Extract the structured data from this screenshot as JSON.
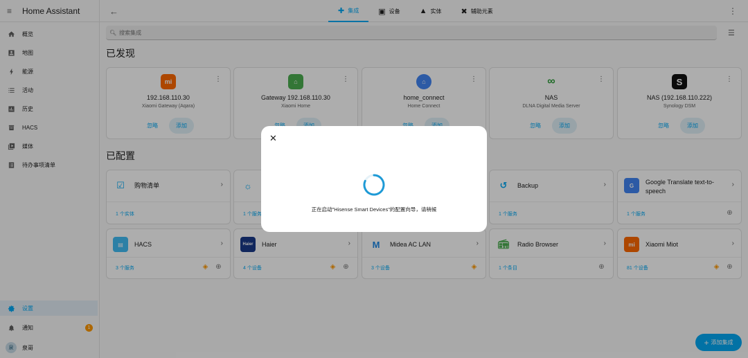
{
  "app": {
    "title": "Home Assistant"
  },
  "sidebar": {
    "items": [
      {
        "label": "概览",
        "icon": "home-icon"
      },
      {
        "label": "地图",
        "icon": "map-icon"
      },
      {
        "label": "能源",
        "icon": "energy-icon"
      },
      {
        "label": "活动",
        "icon": "logbook-icon"
      },
      {
        "label": "历史",
        "icon": "history-icon"
      },
      {
        "label": "HACS",
        "icon": "hacs-icon"
      },
      {
        "label": "媒体",
        "icon": "media-icon"
      },
      {
        "label": "待办事项清单",
        "icon": "todo-icon"
      }
    ],
    "bottom": {
      "settings": "设置",
      "notifications": "通知",
      "notification_count": "1",
      "user": "泉哥",
      "avatar_initial": "泉"
    }
  },
  "topbar": {
    "tabs": [
      {
        "label": "集成",
        "icon": "puzzle-icon",
        "active": true
      },
      {
        "label": "设备",
        "icon": "devices-icon"
      },
      {
        "label": "实体",
        "icon": "shapes-icon"
      },
      {
        "label": "辅助元素",
        "icon": "tools-icon"
      }
    ]
  },
  "search": {
    "placeholder": "搜索集成"
  },
  "discovered": {
    "title": "已发现",
    "ignore_label": "忽略",
    "add_label": "添加",
    "cards": [
      {
        "name": "192.168.110.30",
        "sub": "Xiaomi Gateway (Aqara)",
        "logo": "mi-logo",
        "color": "#ff6900",
        "glyph": "mi"
      },
      {
        "name": "Gateway 192.168.110.30",
        "sub": "Xiaomi Home",
        "logo": "xiaomi-home-logo",
        "color": "#4caf50",
        "glyph": "⌂"
      },
      {
        "name": "home_connect",
        "sub": "Home Connect",
        "logo": "home-connect-logo",
        "color": "#4285f4",
        "glyph": "⌂"
      },
      {
        "name": "NAS",
        "sub": "DLNA Digital Media Server",
        "logo": "dlna-logo",
        "color": "#ffffff",
        "glyph": "∞"
      },
      {
        "name": "NAS (192.168.110.222)",
        "sub": "Synology DSM",
        "logo": "synology-logo",
        "color": "#111111",
        "glyph": "S"
      }
    ]
  },
  "configured": {
    "title": "已配置",
    "cards": [
      {
        "name": "购物清单",
        "count": "1 个实体",
        "logo": "shopping-list-logo",
        "globe": false,
        "pkg": false
      },
      {
        "name": "",
        "count": "1 个服务",
        "logo": "integration-logo",
        "globe": false,
        "pkg": false
      },
      {
        "name": "",
        "count": "",
        "logo": "",
        "globe": false,
        "pkg": false
      },
      {
        "name": "Backup",
        "count": "1 个服务",
        "logo": "backup-logo",
        "globe": false,
        "pkg": false
      },
      {
        "name": "Google Translate text-to-speech",
        "count": "1 个服务",
        "logo": "google-translate-logo",
        "globe": true,
        "pkg": false
      },
      {
        "name": "HACS",
        "count": "3 个服务",
        "logo": "hacs-logo",
        "globe": true,
        "pkg": true
      },
      {
        "name": "Haier",
        "count": "4 个设备",
        "logo": "haier-logo",
        "globe": true,
        "pkg": true
      },
      {
        "name": "Midea AC LAN",
        "count": "3 个设备",
        "logo": "midea-logo",
        "globe": false,
        "pkg": true
      },
      {
        "name": "Radio Browser",
        "count": "1 个条目",
        "logo": "radio-browser-logo",
        "globe": true,
        "pkg": false
      },
      {
        "name": "Xiaomi Miot",
        "count": "81 个设备",
        "logo": "xiaomi-miot-logo",
        "globe": true,
        "pkg": true
      }
    ]
  },
  "dialog": {
    "message": "正在启动\"Hisense Smart Devices\"的配置向导，请稍候"
  },
  "fab": {
    "label": "添加集成"
  },
  "colors": {
    "accent": "#03a9f4",
    "badge": "#ff9800"
  }
}
